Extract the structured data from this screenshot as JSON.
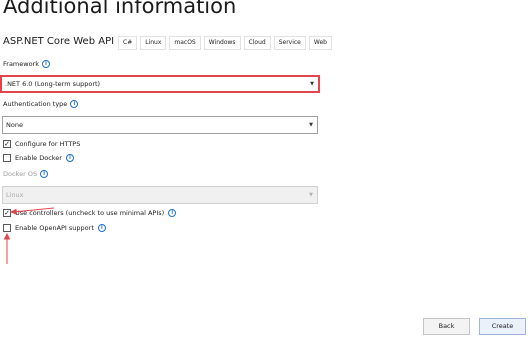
{
  "header": {
    "title": "Additional information",
    "subtitle": "ASP.NET Core Web API",
    "tags": [
      "C#",
      "Linux",
      "macOS",
      "Windows",
      "Cloud",
      "Service",
      "Web"
    ]
  },
  "framework": {
    "label": "Framework",
    "value": ".NET 6.0 (Long-term support)"
  },
  "authentication": {
    "label": "Authentication type",
    "value": "None"
  },
  "checkboxes": {
    "https": {
      "label": "Configure for HTTPS",
      "checked": true
    },
    "docker": {
      "label": "Enable Docker",
      "checked": false
    },
    "controllers": {
      "label": "Use controllers (uncheck to use minimal APIs)",
      "checked": true
    },
    "openapi": {
      "label": "Enable OpenAPI support",
      "checked": false
    }
  },
  "docker_os": {
    "label": "Docker OS",
    "value": "Linux",
    "enabled": false
  },
  "footer": {
    "back_label": "Back",
    "create_label": "Create"
  },
  "colors": {
    "highlight": "#e0474c",
    "info": "#1e6fcc"
  },
  "icons": {
    "info": "info-circle-icon",
    "dropdown": "chevron-down-icon",
    "check": "checkmark-icon"
  }
}
